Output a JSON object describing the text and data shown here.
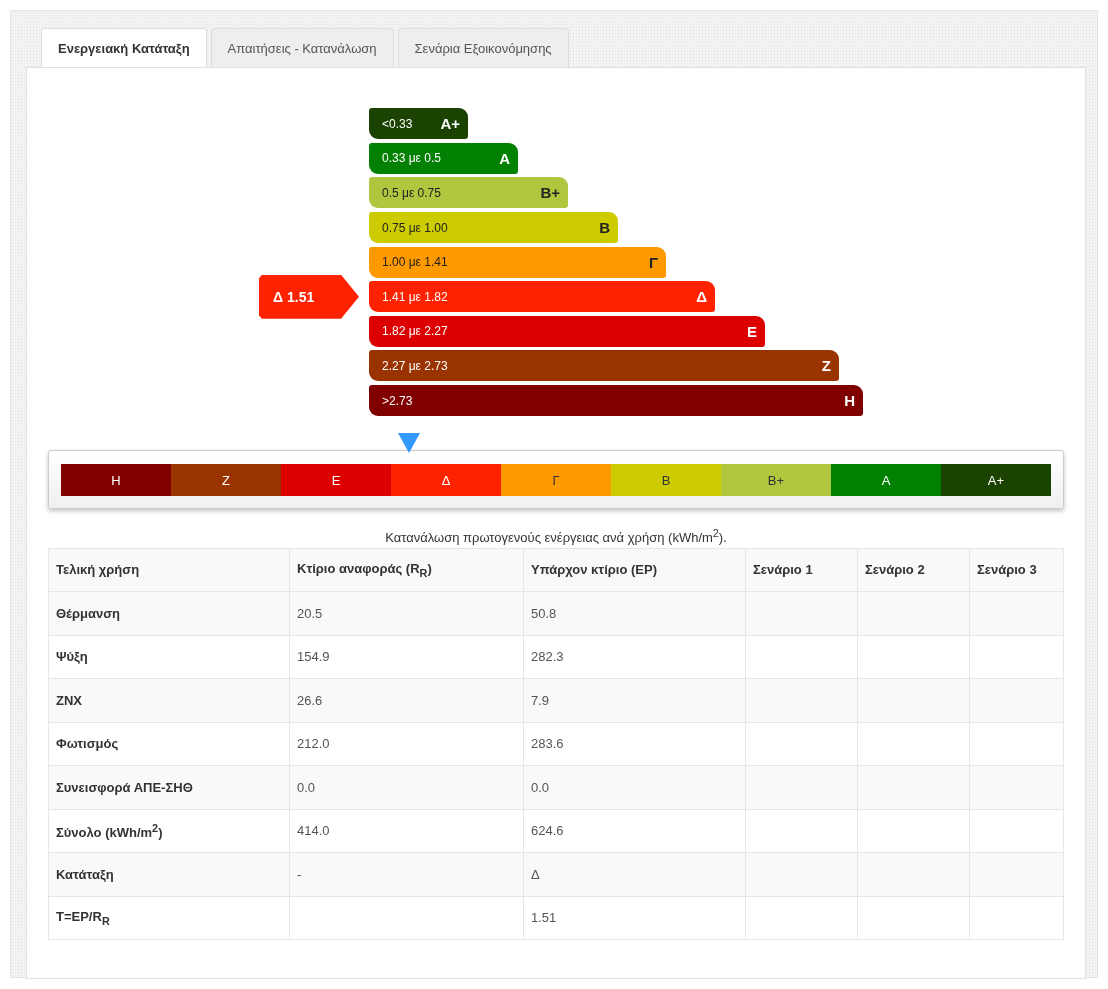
{
  "tabs": [
    {
      "label": "Ενεργειακή Κατάταξη",
      "selected": true
    },
    {
      "label": "Απαιτήσεις - Κατανάλωση",
      "selected": false
    },
    {
      "label": "Σενάρια Εξοικονόμησης",
      "selected": false
    }
  ],
  "rating": {
    "indicator": "Δ 1.51",
    "bars": [
      {
        "range": "<0.33",
        "class": "A+",
        "color": "#1a4200",
        "dark_text": false,
        "selected": false
      },
      {
        "range": "0.33 με 0.5",
        "class": "A",
        "color": "#028002",
        "dark_text": false,
        "selected": false
      },
      {
        "range": "0.5 με 0.75",
        "class": "B+",
        "color": "#afc63f",
        "dark_text": true,
        "selected": false
      },
      {
        "range": "0.75 με 1.00",
        "class": "B",
        "color": "#cccc00",
        "dark_text": true,
        "selected": false
      },
      {
        "range": "1.00 με 1.41",
        "class": "Γ",
        "color": "#ff9900",
        "dark_text": true,
        "selected": false
      },
      {
        "range": "1.41 με 1.82",
        "class": "Δ",
        "color": "#ff2200",
        "dark_text": false,
        "selected": true
      },
      {
        "range": "1.82 με 2.27",
        "class": "Ε",
        "color": "#dd0000",
        "dark_text": false,
        "selected": false
      },
      {
        "range": "2.27 με 2.73",
        "class": "Ζ",
        "color": "#993300",
        "dark_text": false,
        "selected": false
      },
      {
        "range": ">2.73",
        "class": "Η",
        "color": "#800000",
        "dark_text": false,
        "selected": false
      }
    ]
  },
  "scale": [
    {
      "label": "Η",
      "color": "#800000",
      "dark_text": false,
      "selected": false
    },
    {
      "label": "Ζ",
      "color": "#993300",
      "dark_text": false,
      "selected": false
    },
    {
      "label": "Ε",
      "color": "#dd0000",
      "dark_text": false,
      "selected": false
    },
    {
      "label": "Δ",
      "color": "#ff2200",
      "dark_text": false,
      "selected": true
    },
    {
      "label": "Γ",
      "color": "#ff9900",
      "dark_text": true,
      "selected": false
    },
    {
      "label": "Β",
      "color": "#cccc00",
      "dark_text": true,
      "selected": false
    },
    {
      "label": "Β+",
      "color": "#afc63f",
      "dark_text": true,
      "selected": false
    },
    {
      "label": "Α",
      "color": "#028002",
      "dark_text": false,
      "selected": false
    },
    {
      "label": "Α+",
      "color": "#1a4200",
      "dark_text": false,
      "selected": false
    }
  ],
  "table": {
    "caption": "Κατανάλωση πρωτογενούς ενέργειας ανά χρήση (kWh/m$^{2}$).",
    "columns": [
      "Τελική χρήση",
      "Κτίριο αναφοράς (R$_{R}$)",
      "Υπάρχον κτίριο (EP)",
      "Σενάριο 1",
      "Σενάριο 2",
      "Σενάριο 3"
    ],
    "rows": [
      {
        "label": "Θέρμανση",
        "reference": "20.5",
        "existing": "50.8"
      },
      {
        "label": "Ψύξη",
        "reference": "154.9",
        "existing": "282.3"
      },
      {
        "label": "ΖΝΧ",
        "reference": "26.6",
        "existing": "7.9"
      },
      {
        "label": "Φωτισμός",
        "reference": "212.0",
        "existing": "283.6"
      },
      {
        "label": "Συνεισφορά ΑΠΕ-ΣΗΘ",
        "reference": "0.0",
        "existing": "0.0"
      },
      {
        "label": "Σύνολο (kWh/m$^{2}$)",
        "reference": "414.0",
        "existing": "624.6"
      },
      {
        "label": "Κατάταξη",
        "reference": "-",
        "existing": "Δ"
      },
      {
        "label": "T=EP/R$_{R}$",
        "existing": "1.51"
      }
    ]
  }
}
